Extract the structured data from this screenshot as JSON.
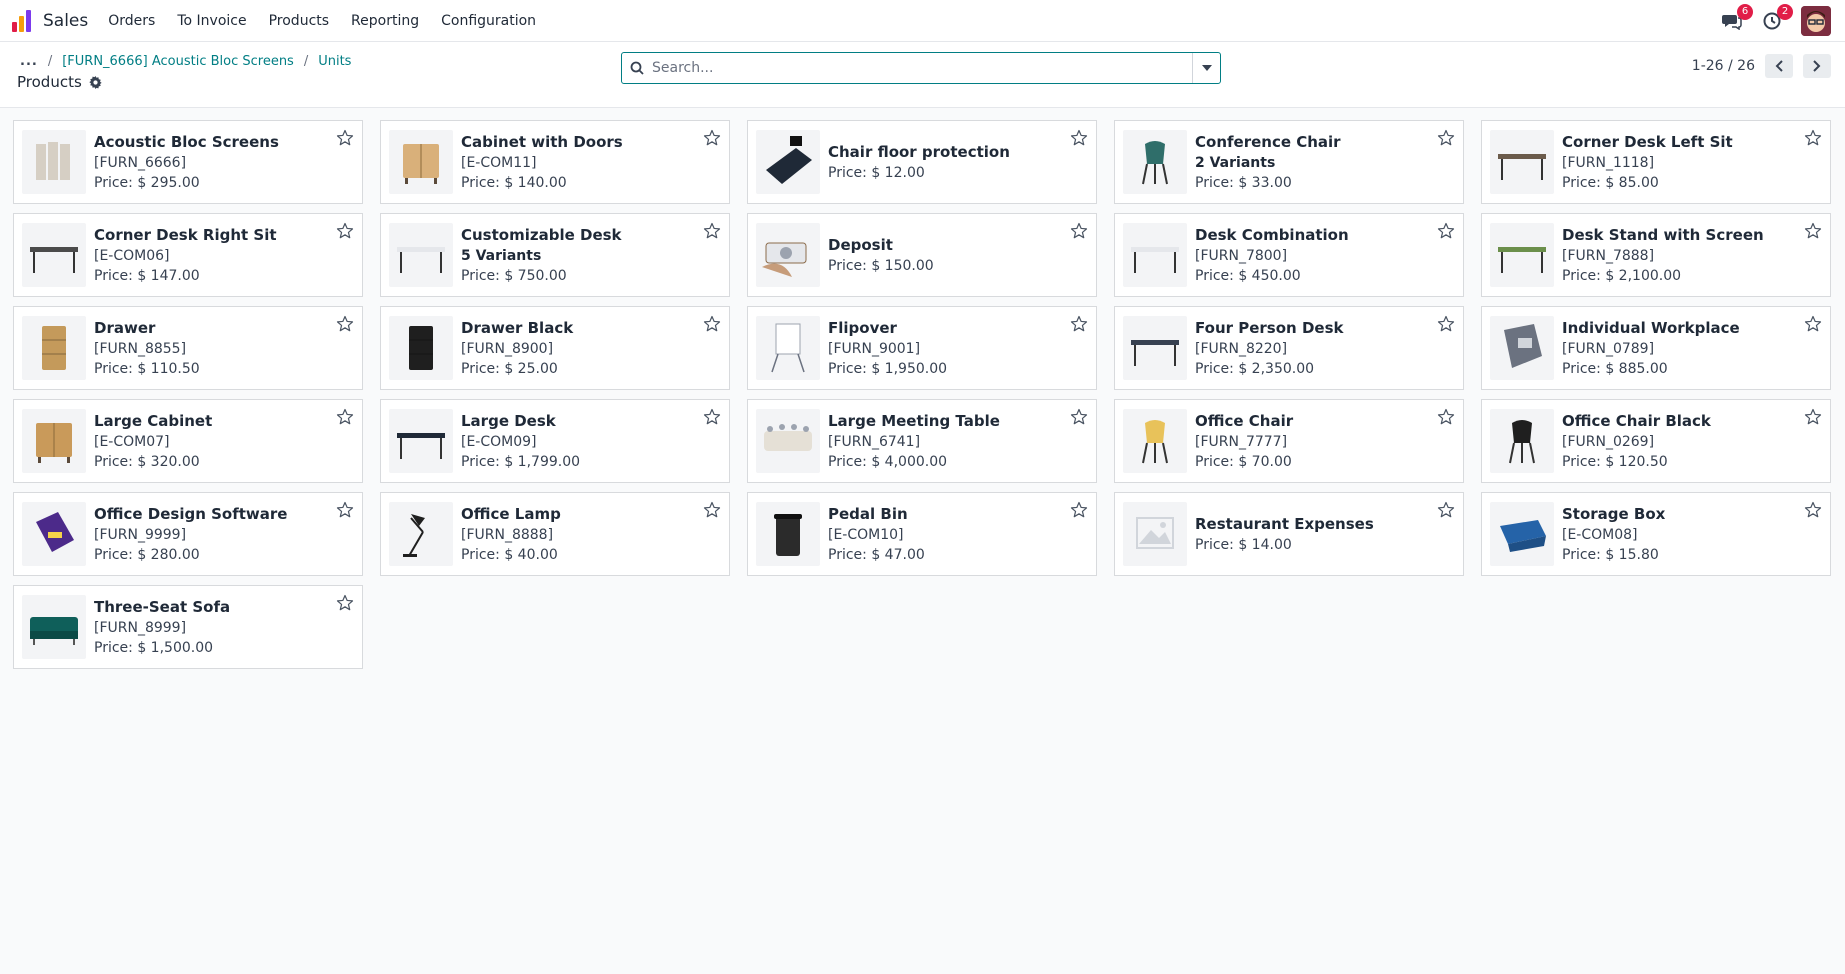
{
  "navbar": {
    "app_name": "Sales",
    "menu": [
      "Orders",
      "To Invoice",
      "Products",
      "Reporting",
      "Configuration"
    ],
    "messages_count": "6",
    "activities_count": "2"
  },
  "breadcrumb": {
    "ellipsis": "...",
    "items": [
      "[FURN_6666] Acoustic Bloc Screens",
      "Units"
    ]
  },
  "page_title": "Products",
  "search": {
    "placeholder": "Search..."
  },
  "pager": {
    "text": "1-26 / 26"
  },
  "products": [
    {
      "name": "Acoustic Bloc Screens",
      "ref": "[FURN_6666]",
      "price": "Price: $ 295.00",
      "icon": "screen-icon",
      "color": "#d6cfc4"
    },
    {
      "name": "Cabinet with Doors",
      "ref": "[E-COM11]",
      "price": "Price: $ 140.00",
      "icon": "cabinet-icon",
      "color": "#d9b07a"
    },
    {
      "name": "Chair floor protection",
      "ref": "",
      "price": "Price: $ 12.00",
      "icon": "floor-mat-icon",
      "color": "#1f2937"
    },
    {
      "name": "Conference Chair",
      "variants": "2 Variants",
      "price": "Price: $ 33.00",
      "icon": "chair-icon",
      "color": "#2f6e6a"
    },
    {
      "name": "Corner Desk Left Sit",
      "ref": "[FURN_1118]",
      "price": "Price: $ 85.00",
      "icon": "desk-icon",
      "color": "#6b5b4b"
    },
    {
      "name": "Corner Desk Right Sit",
      "ref": "[E-COM06]",
      "price": "Price: $ 147.00",
      "icon": "desk-icon",
      "color": "#4b4b4b"
    },
    {
      "name": "Customizable Desk",
      "variants": "5 Variants",
      "price": "Price: $ 750.00",
      "icon": "desk-icon",
      "color": "#e5e7eb"
    },
    {
      "name": "Deposit",
      "ref": "",
      "price": "Price: $ 150.00",
      "icon": "money-icon",
      "color": "#8b6b4b"
    },
    {
      "name": "Desk Combination",
      "ref": "[FURN_7800]",
      "price": "Price: $ 450.00",
      "icon": "desk-icon",
      "color": "#e5e7eb"
    },
    {
      "name": "Desk Stand with Screen",
      "ref": "[FURN_7888]",
      "price": "Price: $ 2,100.00",
      "icon": "desk-icon",
      "color": "#6b8f4b"
    },
    {
      "name": "Drawer",
      "ref": "[FURN_8855]",
      "price": "Price: $ 110.50",
      "icon": "drawer-icon",
      "color": "#c49a5b"
    },
    {
      "name": "Drawer Black",
      "ref": "[FURN_8900]",
      "price": "Price: $ 25.00",
      "icon": "drawer-icon",
      "color": "#1f1f1f"
    },
    {
      "name": "Flipover",
      "ref": "[FURN_9001]",
      "price": "Price: $ 1,950.00",
      "icon": "flipchart-icon",
      "color": "#d1d5db"
    },
    {
      "name": "Four Person Desk",
      "ref": "[FURN_8220]",
      "price": "Price: $ 2,350.00",
      "icon": "desk-icon",
      "color": "#374151"
    },
    {
      "name": "Individual Workplace",
      "ref": "[FURN_0789]",
      "price": "Price: $ 885.00",
      "icon": "workplace-icon",
      "color": "#6b7280"
    },
    {
      "name": "Large Cabinet",
      "ref": "[E-COM07]",
      "price": "Price: $ 320.00",
      "icon": "cabinet-icon",
      "color": "#c99a5a"
    },
    {
      "name": "Large Desk",
      "ref": "[E-COM09]",
      "price": "Price: $ 1,799.00",
      "icon": "desk-icon",
      "color": "#1f2937"
    },
    {
      "name": "Large Meeting Table",
      "ref": "[FURN_6741]",
      "price": "Price: $ 4,000.00",
      "icon": "table-icon",
      "color": "#9ca3af"
    },
    {
      "name": "Office Chair",
      "ref": "[FURN_7777]",
      "price": "Price: $ 70.00",
      "icon": "chair-icon",
      "color": "#e8c25a"
    },
    {
      "name": "Office Chair Black",
      "ref": "[FURN_0269]",
      "price": "Price: $ 120.50",
      "icon": "chair-icon",
      "color": "#1f1f1f"
    },
    {
      "name": "Office Design Software",
      "ref": "[FURN_9999]",
      "price": "Price: $ 280.00",
      "icon": "software-box-icon",
      "color": "#4c2a8a"
    },
    {
      "name": "Office Lamp",
      "ref": "[FURN_8888]",
      "price": "Price: $ 40.00",
      "icon": "lamp-icon",
      "color": "#1f1f1f"
    },
    {
      "name": "Pedal Bin",
      "ref": "[E-COM10]",
      "price": "Price: $ 47.00",
      "icon": "bin-icon",
      "color": "#2b2b2b"
    },
    {
      "name": "Restaurant Expenses",
      "ref": "",
      "price": "Price: $ 14.00",
      "icon": "image-placeholder-icon",
      "color": "#d1d5db"
    },
    {
      "name": "Storage Box",
      "ref": "[E-COM08]",
      "price": "Price: $ 15.80",
      "icon": "box-icon",
      "color": "#2563a8"
    },
    {
      "name": "Three-Seat Sofa",
      "ref": "[FURN_8999]",
      "price": "Price: $ 1,500.00",
      "icon": "sofa-icon",
      "color": "#0f5f5a"
    }
  ],
  "colors": {
    "accent": "#017e84",
    "badge": "#e11d48"
  }
}
